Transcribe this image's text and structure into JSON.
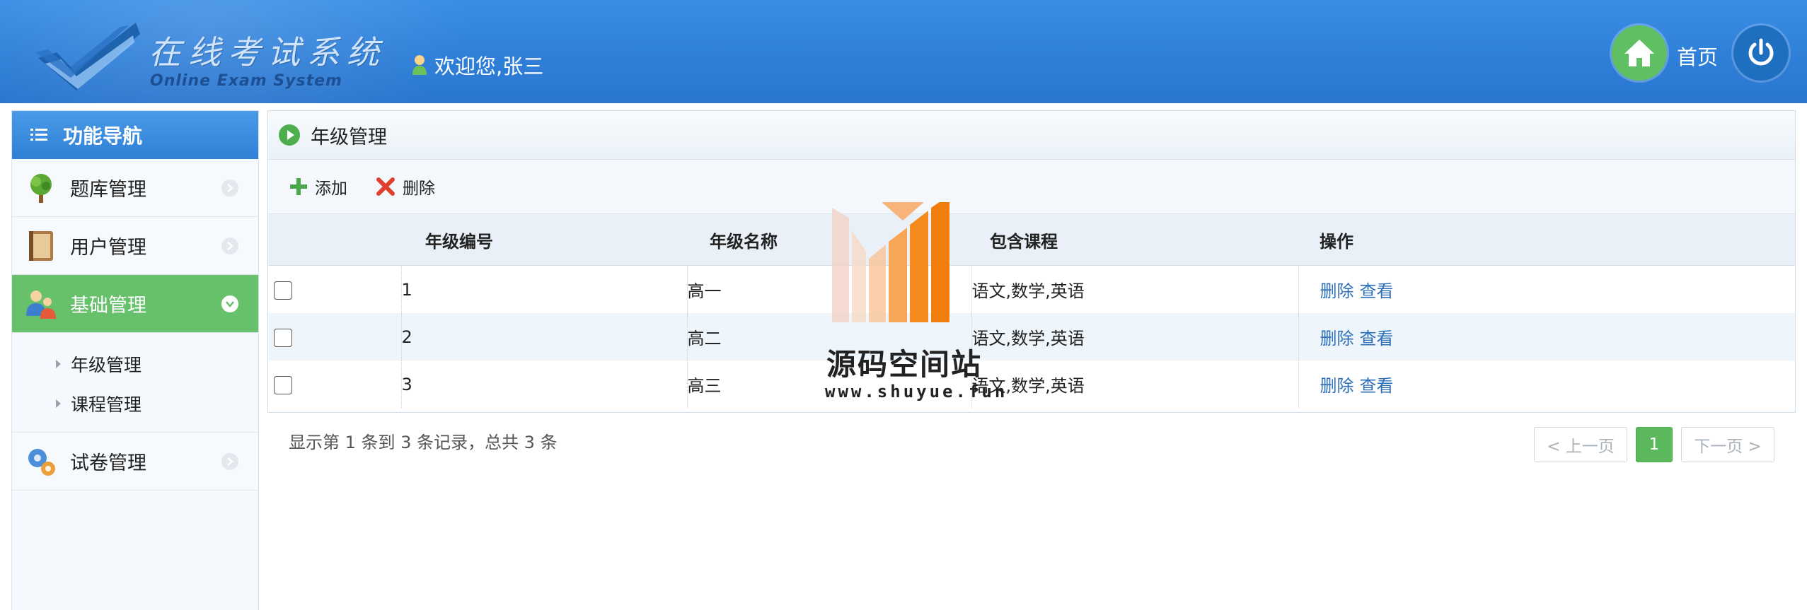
{
  "header": {
    "logo_cn": "在线考试系统",
    "logo_en": "Online Exam System",
    "welcome": "欢迎您,张三",
    "home_label": "首页",
    "home_icon": "home-icon",
    "power_icon": "power-icon",
    "bg_color": "#2f7fd8"
  },
  "sidebar": {
    "title": "功能导航",
    "items": [
      {
        "label": "题库管理",
        "icon": "tree-icon",
        "active": false
      },
      {
        "label": "用户管理",
        "icon": "book-icon",
        "active": false
      },
      {
        "label": "基础管理",
        "icon": "users-icon",
        "active": true,
        "children": [
          {
            "label": "年级管理"
          },
          {
            "label": "课程管理"
          }
        ]
      },
      {
        "label": "试卷管理",
        "icon": "gears-icon",
        "active": false
      }
    ],
    "active_color": "#66c16a"
  },
  "panel": {
    "title": "年级管理",
    "toolbar": {
      "add_label": "添加",
      "delete_label": "删除"
    },
    "columns": [
      "年级编号",
      "年级名称",
      "包含课程",
      "操作"
    ],
    "rows": [
      {
        "id": "1",
        "name": "高一",
        "courses": "语文,数学,英语",
        "delete": "删除",
        "view": "查看"
      },
      {
        "id": "2",
        "name": "高二",
        "courses": "语文,数学,英语",
        "delete": "删除",
        "view": "查看"
      },
      {
        "id": "3",
        "name": "高三",
        "courses": "语文,数学,英语",
        "delete": "删除",
        "view": "查看"
      }
    ]
  },
  "pagination": {
    "summary": "显示第 1 条到 3 条记录，总共 3 条",
    "prev": "< 上一页",
    "current": "1",
    "next": "下一页 >"
  },
  "watermark": {
    "title": "源码空间站",
    "url": "www.shuyue.fun"
  }
}
